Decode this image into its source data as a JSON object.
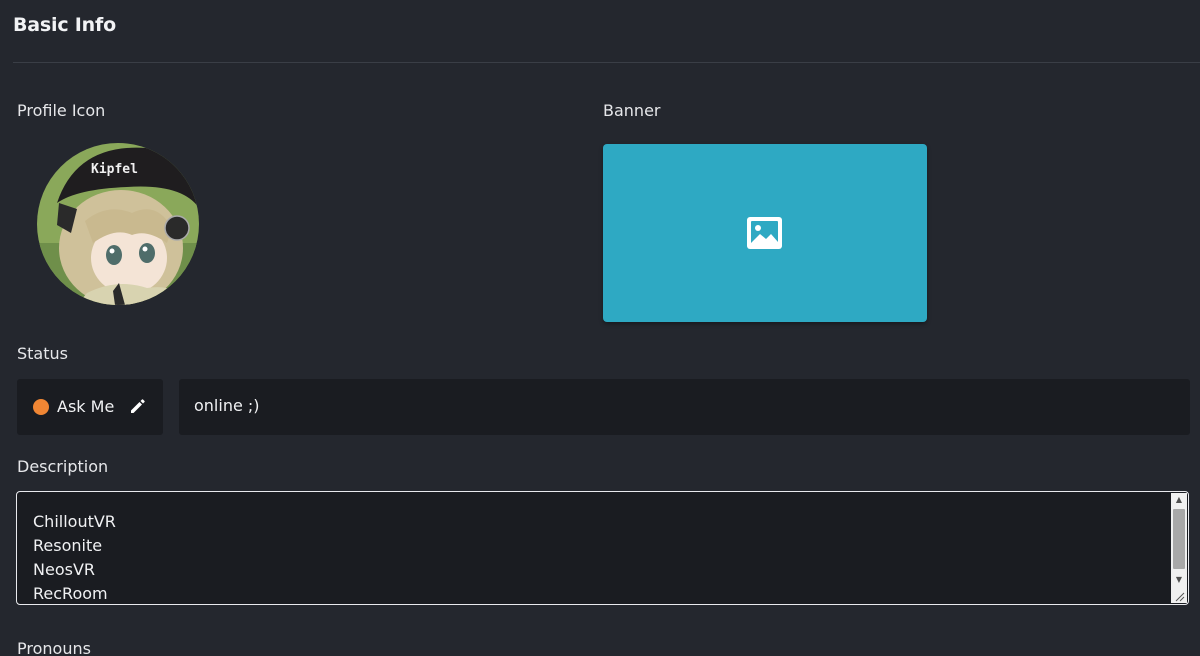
{
  "page": {
    "title": "Basic Info"
  },
  "profile_icon": {
    "label": "Profile Icon",
    "image_text": "Kipfel"
  },
  "banner": {
    "label": "Banner",
    "background_color": "#2ea9c3",
    "icon": "image-placeholder-icon"
  },
  "status": {
    "label": "Status",
    "selected": "Ask Me",
    "dot_color": "#f08634",
    "edit_icon": "pencil-icon",
    "message": "online ;)"
  },
  "description": {
    "label": "Description",
    "lines": [
      "ChilloutVR",
      "Resonite",
      "NeosVR",
      "RecRoom"
    ]
  },
  "pronouns": {
    "label": "Pronouns"
  },
  "colors": {
    "background": "#24272e",
    "field_background": "#1a1c21",
    "accent_status_orange": "#f08634"
  }
}
